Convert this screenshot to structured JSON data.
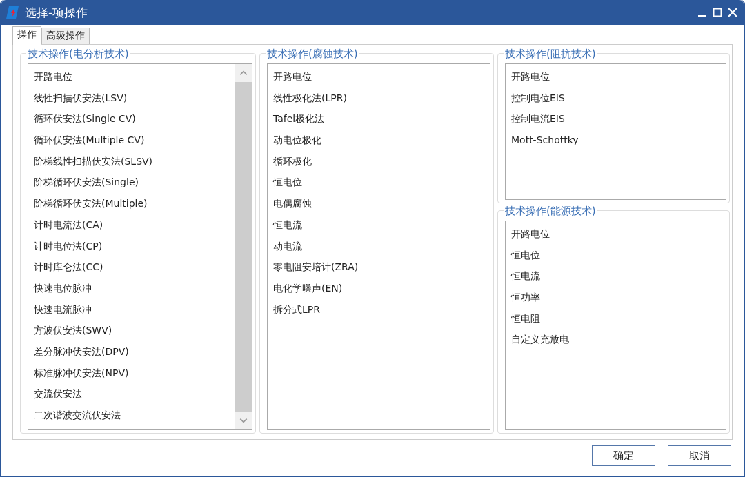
{
  "window": {
    "title": "选择-项操作"
  },
  "tabs": [
    {
      "label": "操作",
      "selected": true
    },
    {
      "label": "高级操作",
      "selected": false
    }
  ],
  "groups": [
    {
      "title": "技术操作(电分析技术)",
      "scrollbar": true,
      "items": [
        "开路电位",
        "线性扫描伏安法(LSV)",
        "循环伏安法(Single CV)",
        "循环伏安法(Multiple CV)",
        "阶梯线性扫描伏安法(SLSV)",
        "阶梯循环伏安法(Single)",
        "阶梯循环伏安法(Multiple)",
        "计时电流法(CA)",
        "计时电位法(CP)",
        "计时库仑法(CC)",
        "快速电位脉冲",
        "快速电流脉冲",
        "方波伏安法(SWV)",
        "差分脉冲伏安法(DPV)",
        "标准脉冲伏安法(NPV)",
        "交流伏安法",
        "二次谐波交流伏安法"
      ]
    },
    {
      "title": "技术操作(腐蚀技术)",
      "scrollbar": false,
      "items": [
        "开路电位",
        "线性极化法(LPR)",
        "Tafel极化法",
        "动电位极化",
        "循环极化",
        "恒电位",
        "电偶腐蚀",
        "恒电流",
        "动电流",
        "零电阻安培计(ZRA)",
        "电化学噪声(EN)",
        "拆分式LPR"
      ]
    },
    {
      "title": "技术操作(阻抗技术)",
      "scrollbar": false,
      "items": [
        "开路电位",
        "控制电位EIS",
        "控制电流EIS",
        "Mott-Schottky"
      ]
    },
    {
      "title": "技术操作(能源技术)",
      "scrollbar": false,
      "items": [
        "开路电位",
        "恒电位",
        "恒电流",
        "恒功率",
        "恒电阻",
        "自定义充放电"
      ]
    }
  ],
  "buttons": [
    "确定",
    "取消"
  ]
}
